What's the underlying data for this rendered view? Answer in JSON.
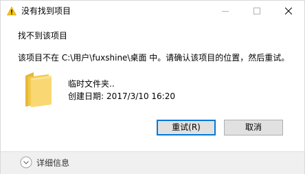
{
  "window": {
    "title": "没有找到项目",
    "icon": "warning-icon",
    "controls": {
      "minimize": "minimize-icon",
      "maximize": "maximize-icon",
      "close": "close-icon"
    }
  },
  "dialog": {
    "heading": "找不到该项目",
    "message": "该项目不在 C:\\用户\\fuxshine\\桌面 中。请确认该项目的位置，然后重试。",
    "item": {
      "icon": "folder-icon",
      "name": "临时文件夹..",
      "date_label": "创建日期:",
      "date_value": "2017/3/10 16:20"
    },
    "buttons": {
      "retry": "重试(R)",
      "cancel": "取消"
    },
    "footer": {
      "details_label": "详细信息",
      "details_icon": "chevron-down-icon"
    }
  },
  "colors": {
    "warning_yellow": "#f5c518",
    "folder_yellow": "#f6cf5a",
    "accent_blue": "#0078d7",
    "footer_bg": "#f0f0f0",
    "button_bg": "#e1e1e1"
  }
}
